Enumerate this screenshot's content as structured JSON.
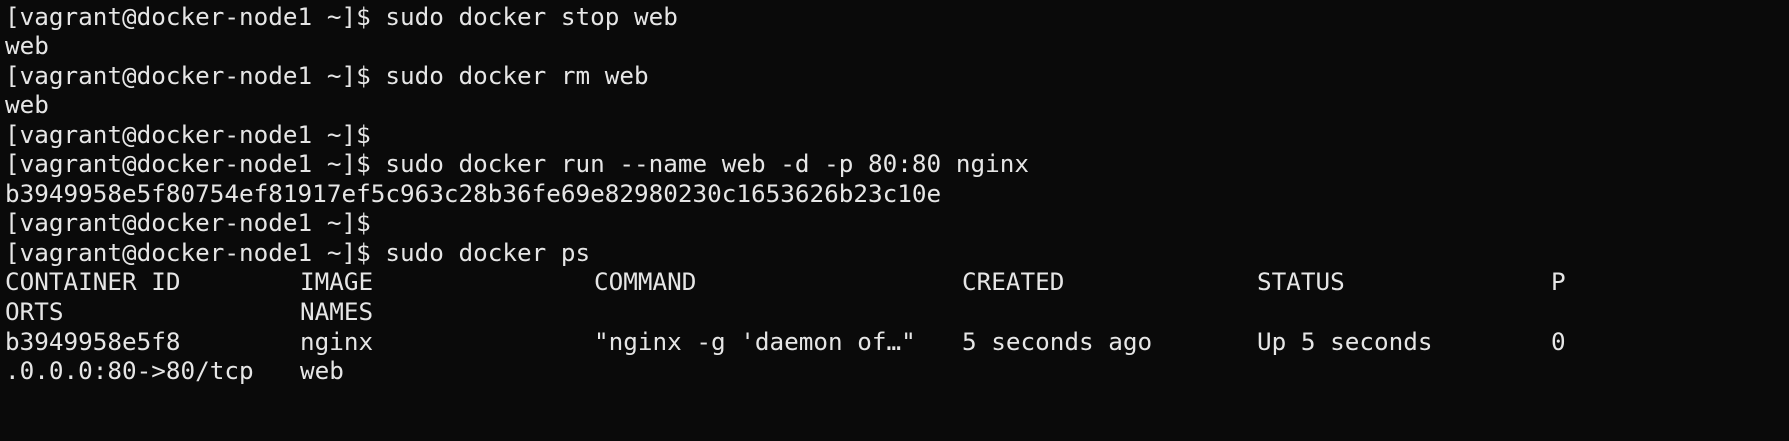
{
  "terminal": {
    "prompt": "[vagrant@docker-node1 ~]$ ",
    "lines": [
      {
        "text": "[vagrant@docker-node1 ~]$ sudo docker stop web"
      },
      {
        "text": "web"
      },
      {
        "text": "[vagrant@docker-node1 ~]$ sudo docker rm web"
      },
      {
        "text": "web"
      },
      {
        "text": "[vagrant@docker-node1 ~]$"
      },
      {
        "text": "[vagrant@docker-node1 ~]$ sudo docker run --name web -d -p 80:80 nginx"
      },
      {
        "text": "b3949958e5f80754ef81917ef5c963c28b36fe69e82980230c1653626b23c10e"
      },
      {
        "text": "[vagrant@docker-node1 ~]$"
      },
      {
        "text": "[vagrant@docker-node1 ~]$ sudo docker ps"
      }
    ],
    "ps_header": {
      "container_id": "CONTAINER ID",
      "image": "IMAGE",
      "command": "COMMAND",
      "created": "CREATED",
      "status": "STATUS",
      "ports_wrap_start": "P",
      "ports_wrap_rest": "ORTS",
      "names": "NAMES"
    },
    "ps_rows": [
      {
        "container_id": "b3949958e5f8",
        "image": "nginx",
        "command": "\"nginx -g 'daemon of…\"",
        "created": "5 seconds ago",
        "status": "Up 5 seconds",
        "ports_wrap_start": "0",
        "ports_wrap_rest": ".0.0.0:80->80/tcp",
        "names": "web"
      }
    ]
  },
  "colors": {
    "background": "#0a0a0a",
    "foreground": "#e6e6e6"
  }
}
